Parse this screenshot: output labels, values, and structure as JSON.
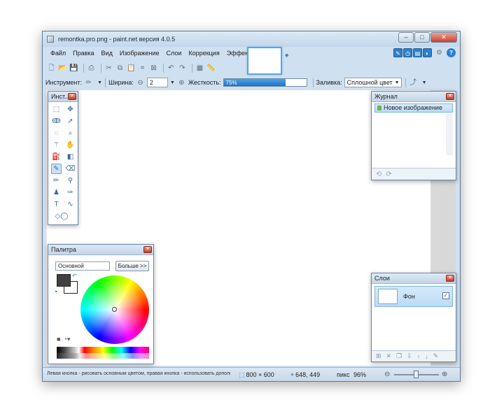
{
  "window": {
    "title": "remontka.pro.png - paint.net версия 4.0.5",
    "controls": {
      "minimize": "–",
      "maximize": "□",
      "close": "✕"
    }
  },
  "menu": {
    "items": [
      "Файл",
      "Правка",
      "Вид",
      "Изображение",
      "Слои",
      "Коррекция",
      "Эффекты"
    ]
  },
  "toolbar": {
    "tool_label": "Инструмент:",
    "width_label": "Ширина:",
    "width_value": "2",
    "hardness_label": "Жесткость:",
    "hardness_value": "75%",
    "hardness_level": 0.75,
    "fill_label": "Заливка:",
    "fill_value": "Сплошной цвет"
  },
  "tools_panel": {
    "title": "Инст..."
  },
  "history_panel": {
    "title": "Журнал",
    "items": [
      "Новое изображение"
    ]
  },
  "palette_panel": {
    "title": "Палитра",
    "mode_select": "Основной",
    "more_button": "Больше >>",
    "primary_color": "#404040",
    "secondary_color": "#ffffff"
  },
  "layers_panel": {
    "title": "Слои",
    "layers": [
      {
        "name": "Фон",
        "visible": true
      }
    ]
  },
  "status": {
    "hint": "Левая кнопка - рисовать основным цветом, правая кнопка - использовать дополнительным цветом.",
    "image_size": "800 × 600",
    "cursor_pos": "648, 449",
    "units": "пикс",
    "zoom": "96%"
  },
  "colors": {
    "accent": "#2f80c8",
    "canvas": "#ffffff",
    "window_bg": "#cfe0f1"
  }
}
